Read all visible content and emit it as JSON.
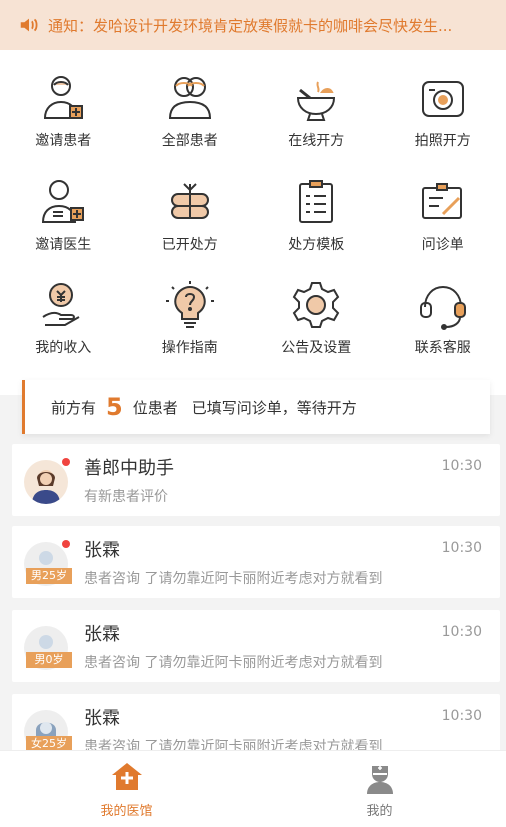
{
  "notice": {
    "label": "通知：",
    "text": "发哈设计开发环境肯定放寒假就卡的咖啡会尽快发生..."
  },
  "grid": [
    {
      "label": "邀请患者",
      "icon": "invite-patient-icon"
    },
    {
      "label": "全部患者",
      "icon": "all-patients-icon"
    },
    {
      "label": "在线开方",
      "icon": "online-prescription-icon"
    },
    {
      "label": "拍照开方",
      "icon": "camera-icon"
    },
    {
      "label": "邀请医生",
      "icon": "invite-doctor-icon"
    },
    {
      "label": "已开处方",
      "icon": "prescribed-icon"
    },
    {
      "label": "处方模板",
      "icon": "template-icon"
    },
    {
      "label": "问诊单",
      "icon": "questionnaire-icon"
    },
    {
      "label": "我的收入",
      "icon": "income-icon"
    },
    {
      "label": "操作指南",
      "icon": "guide-icon"
    },
    {
      "label": "公告及设置",
      "icon": "settings-icon"
    },
    {
      "label": "联系客服",
      "icon": "support-icon"
    }
  ],
  "queue": {
    "prefix": "前方有",
    "count": "5",
    "suffix": "位患者",
    "tail": "已填写问诊单，等待开方"
  },
  "messages": [
    {
      "name": "善郎中助手",
      "text": "有新患者评价",
      "time": "10:30",
      "tag": "",
      "unread": true
    },
    {
      "name": "张霖",
      "text": "患者咨询 了请勿靠近阿卡丽附近考虑对方就看到",
      "time": "10:30",
      "tag": "男25岁",
      "unread": true
    },
    {
      "name": "张霖",
      "text": "患者咨询 了请勿靠近阿卡丽附近考虑对方就看到",
      "time": "10:30",
      "tag": "男0岁",
      "unread": false
    },
    {
      "name": "张霖",
      "text": "患者咨询 了请勿靠近阿卡丽附近考虑对方就看到",
      "time": "10:30",
      "tag": "女25岁",
      "unread": false
    }
  ],
  "tabs": [
    {
      "label": "我的医馆",
      "active": true
    },
    {
      "label": "我的",
      "active": false
    }
  ],
  "colors": {
    "accent": "#e07a2e",
    "notice_bg": "#f7e3d4",
    "badge": "#f0443f"
  }
}
